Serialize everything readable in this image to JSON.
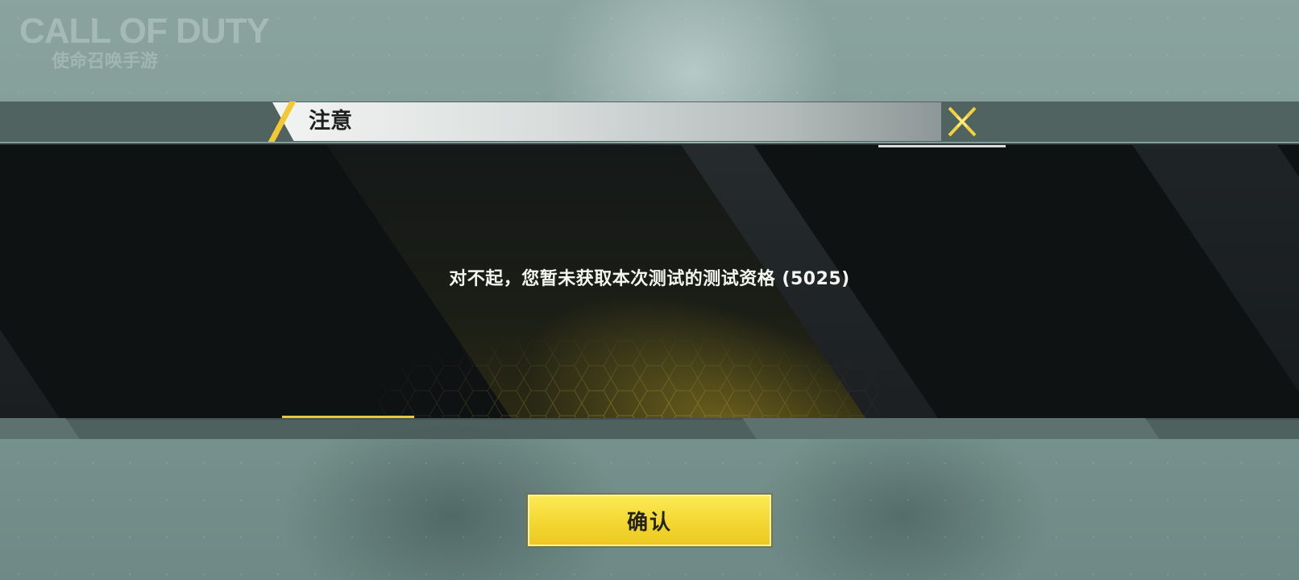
{
  "logo": {
    "main_text": "CALL OF DUTY",
    "sub_text": "使命召唤手游"
  },
  "dialog": {
    "title": "注意",
    "message": "对不起，您暂未获取本次测试的测试资格 (5025)",
    "confirm_label": "确认",
    "close_icon": "close-x-icon"
  },
  "colors": {
    "accent": "#f2c935",
    "button": "#f4d834",
    "panel": "#0e1213"
  }
}
